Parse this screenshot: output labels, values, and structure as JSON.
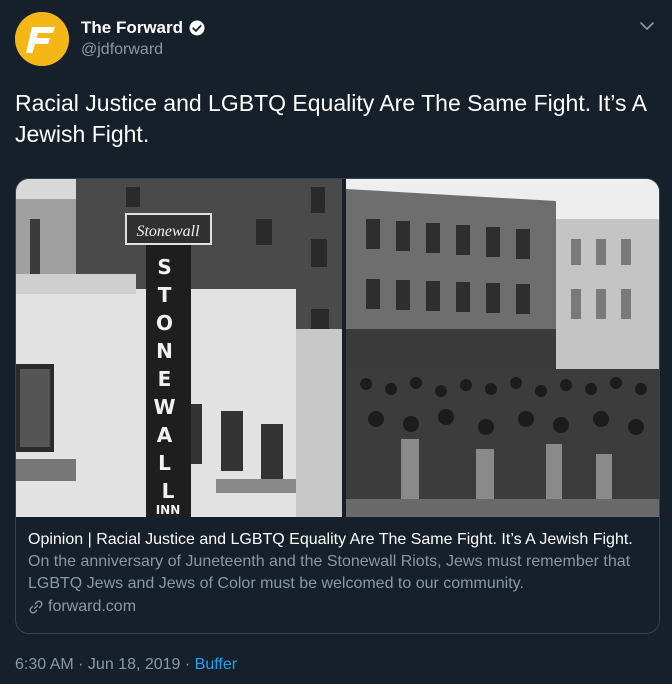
{
  "account": {
    "display_name": "The Forward",
    "handle": "@jdforward",
    "avatar_icon": "forward-logo-icon",
    "verified_icon": "verified-badge-icon",
    "avatar_color": "#f5b716"
  },
  "tweet": {
    "text": "Racial Justice and LGBTQ Equality Are The Same Fight. It’s A Jewish Fight."
  },
  "card": {
    "left_photo_sign_text": "STONEWALL INN",
    "title": "Opinion | Racial Justice and LGBTQ Equality Are The Same Fight. It’s A Jewish Fight.",
    "description": "On the anniversary of Juneteenth and the Stonewall Riots, Jews must remember that LGBTQ Jews and Jews of Color must be welcomed to our community.",
    "domain": "forward.com",
    "link_icon": "link-icon"
  },
  "meta": {
    "time": "6:30 AM",
    "separator1": " · ",
    "date": "Jun 18, 2019",
    "separator2": " · ",
    "source": "Buffer"
  },
  "colors": {
    "background": "#15202b",
    "secondary_text": "#8899a6",
    "accent": "#1da1f2",
    "border": "#38444d"
  }
}
